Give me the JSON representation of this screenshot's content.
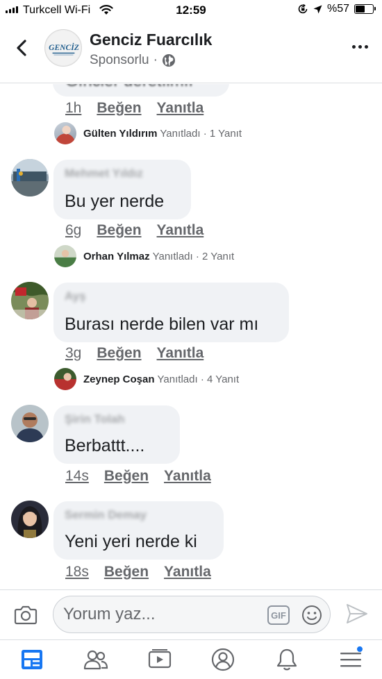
{
  "status_bar": {
    "carrier": "Turkcell Wi-Fi",
    "time": "12:59",
    "battery": "%57",
    "battery_level": 0.57
  },
  "header": {
    "page_name": "Genciz Fuarcılık",
    "sponsored": "Sponsorlu",
    "separator": "·",
    "avatar_logo_text": "GENCİZ",
    "icons": [
      "back-icon",
      "globe-icon",
      "more-options-icon"
    ]
  },
  "partial_comment": {
    "text": "Gıncler ueretılmıı",
    "time": "1h",
    "like": "Beğen",
    "reply": "Yanıtla",
    "reply_preview": {
      "name": "Gülten Yıldırım",
      "action": "Yanıtladı",
      "count": "· 1 Yanıt"
    }
  },
  "comments": [
    {
      "author": "Mehmet Yıldız",
      "text": "Bu yer nerde",
      "time": "6g",
      "like": "Beğen",
      "reply": "Yanıtla",
      "reply_preview": {
        "name": "Orhan Yılmaz",
        "action": "Yanıtladı",
        "count": "· 2 Yanıt"
      }
    },
    {
      "author": "Ayş",
      "text": "Burası nerde bilen var mı",
      "time": "3g",
      "like": "Beğen",
      "reply": "Yanıtla",
      "reply_preview": {
        "name": "Zeynep Coşan",
        "action": "Yanıtladı",
        "count": "· 4 Yanıt"
      }
    },
    {
      "author": "Şirin Tolah",
      "text": "Berbattt....",
      "time": "14s",
      "like": "Beğen",
      "reply": "Yanıtla"
    },
    {
      "author": "Sermin Demay",
      "text": "Yeni yeri nerde ki",
      "time": "18s",
      "like": "Beğen",
      "reply": "Yanıtla"
    }
  ],
  "composer": {
    "placeholder": "Yorum yaz...",
    "gif_label": "GIF",
    "icons": [
      "camera-icon",
      "gif-icon",
      "emoji-icon",
      "send-icon"
    ]
  },
  "bottom_nav": {
    "items": [
      "news-feed-icon",
      "friends-icon",
      "watch-icon",
      "profile-icon",
      "notifications-icon",
      "menu-icon"
    ],
    "active": "news-feed-icon"
  },
  "colors": {
    "accent": "#1877f2",
    "bubble": "#f0f2f5",
    "secondary_text": "#65676b"
  }
}
